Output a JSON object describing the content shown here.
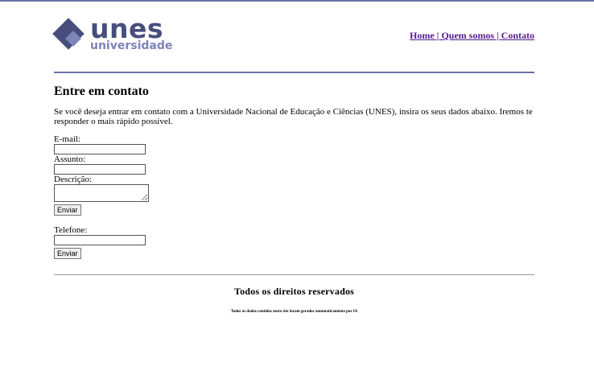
{
  "logo": {
    "word_main": "unes",
    "word_sub": "universidade"
  },
  "nav": {
    "home": "Home",
    "sep1": " | ",
    "about": "Quem somos",
    "sep2": " | ",
    "contact": "Contato"
  },
  "page": {
    "title": "Entre em contato",
    "intro": "Se você deseja entrar em contato com a Universidade Nacional de Educação e Ciências (UNES), insira os seus dados abaixo. Iremos te responder o mais rápido possível."
  },
  "form": {
    "email_label": "E-mail:",
    "subject_label": "Assunto:",
    "description_label": "Descrição:",
    "submit_label": "Enviar"
  },
  "phone_form": {
    "phone_label": "Telefone:",
    "submit_label": "Enviar"
  },
  "footer": {
    "title": "Todos os direitos reservados",
    "note": "Todos os dados contidos neste site foram gerados automaticamente por IA"
  },
  "colors": {
    "brand_dark": "#474e7e",
    "brand_light": "#7c84b8",
    "rule": "#6b73a6",
    "link": "#551a8b"
  }
}
